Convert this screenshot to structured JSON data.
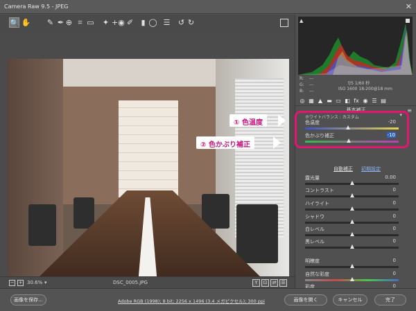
{
  "window": {
    "title": "Camera Raw 9.5  -  JPEG",
    "close_glyph": "✕"
  },
  "toolbar": {
    "tools": [
      {
        "name": "zoom-tool-icon",
        "glyph": "🔍"
      },
      {
        "name": "hand-tool-icon",
        "glyph": "✋"
      },
      {
        "name": "white-balance-tool-icon",
        "glyph": "✎"
      },
      {
        "name": "color-sampler-tool-icon",
        "glyph": "✒"
      },
      {
        "name": "target-adjustment-tool-icon",
        "glyph": "⊕"
      },
      {
        "name": "crop-tool-icon",
        "glyph": "⌗"
      },
      {
        "name": "straighten-tool-icon",
        "glyph": "▭"
      },
      {
        "name": "spot-removal-tool-icon",
        "glyph": "✦"
      },
      {
        "name": "red-eye-tool-icon",
        "glyph": "+◉"
      },
      {
        "name": "adjustment-brush-icon",
        "glyph": "✐"
      },
      {
        "name": "graduated-filter-icon",
        "glyph": "▮"
      },
      {
        "name": "radial-filter-icon",
        "glyph": "◯"
      },
      {
        "name": "preferences-icon",
        "glyph": "☰"
      },
      {
        "name": "rotate-left-icon",
        "glyph": "↺"
      },
      {
        "name": "rotate-right-icon",
        "glyph": "↻"
      }
    ]
  },
  "status": {
    "zoom_minus": "−",
    "zoom_plus": "+",
    "zoom": "30.6%",
    "zoom_arrow": "▾",
    "filename": "DSC_0005.JPG",
    "view_buttons": [
      "Y",
      "⊡",
      "⇄",
      "☰"
    ]
  },
  "histogram": {
    "clip_left": "▲",
    "r_label": "R:",
    "g_label": "G:",
    "b_label": "B:",
    "r_value": "---",
    "g_value": "---",
    "b_value": "---",
    "camera_line1": "f/5   1/60 秒",
    "camera_line2": "ISO 1600   18-200@18 mm"
  },
  "panel": {
    "icons": [
      "◎",
      "▦",
      "▲",
      "▬",
      "▭",
      "◧",
      "fx",
      "◉",
      "☰",
      "▤"
    ],
    "section_title": "基本補正",
    "menu_icon": "≡",
    "white_balance": "ホワイトバランス : カスタム",
    "wb_arrow": "▾",
    "auto": "自動補正",
    "default": "初期設定"
  },
  "sliders": [
    {
      "label": "色温度",
      "value": "-20",
      "position": 0.46,
      "gradient": "linear-gradient(90deg,#3c52c8,#e6d64a)",
      "selected": false
    },
    {
      "label": "色かぶり補正",
      "value": "-10",
      "position": 0.47,
      "gradient": "linear-gradient(90deg,#3bb84b,#c13ab8)",
      "selected": true
    },
    {
      "label": "露光量",
      "value": "0.00",
      "position": 0.5,
      "gradient": "#2b2b2b",
      "selected": false
    },
    {
      "label": "コントラスト",
      "value": "0",
      "position": 0.5,
      "gradient": "#2b2b2b",
      "selected": false
    },
    {
      "label": "ハイライト",
      "value": "0",
      "position": 0.5,
      "gradient": "#2b2b2b",
      "selected": false
    },
    {
      "label": "シャドウ",
      "value": "0",
      "position": 0.5,
      "gradient": "#2b2b2b",
      "selected": false
    },
    {
      "label": "白レベル",
      "value": "0",
      "position": 0.5,
      "gradient": "#2b2b2b",
      "selected": false
    },
    {
      "label": "黒レベル",
      "value": "0",
      "position": 0.5,
      "gradient": "#2b2b2b",
      "selected": false
    },
    {
      "label": "明瞭度",
      "value": "0",
      "position": 0.5,
      "gradient": "#2b2b2b",
      "selected": false
    },
    {
      "label": "自然な彩度",
      "value": "0",
      "position": 0.5,
      "gradient": "linear-gradient(90deg,#888,#c84a4a,#4ac84a,#4a6ac8)",
      "selected": false
    },
    {
      "label": "彩度",
      "value": "0",
      "position": 0.5,
      "gradient": "linear-gradient(90deg,#888,#c84a4a,#c8c84a,#4ac84a,#4a6ac8)",
      "selected": false
    }
  ],
  "callouts": {
    "color_temp": "① 色温度",
    "tint": "② 色かぶり補正"
  },
  "bottom": {
    "save_label": "画像を保存...",
    "info_link": "Adobe RGB (1998); 8 bit; 2256 x 1496 (3.4 メガピクセル); 300 ppi",
    "open_label": "画像を開く",
    "cancel_label": "キャンセル",
    "done_label": "完了"
  },
  "colors": {
    "accent": "#e4156f",
    "selection": "#2f63c8"
  }
}
